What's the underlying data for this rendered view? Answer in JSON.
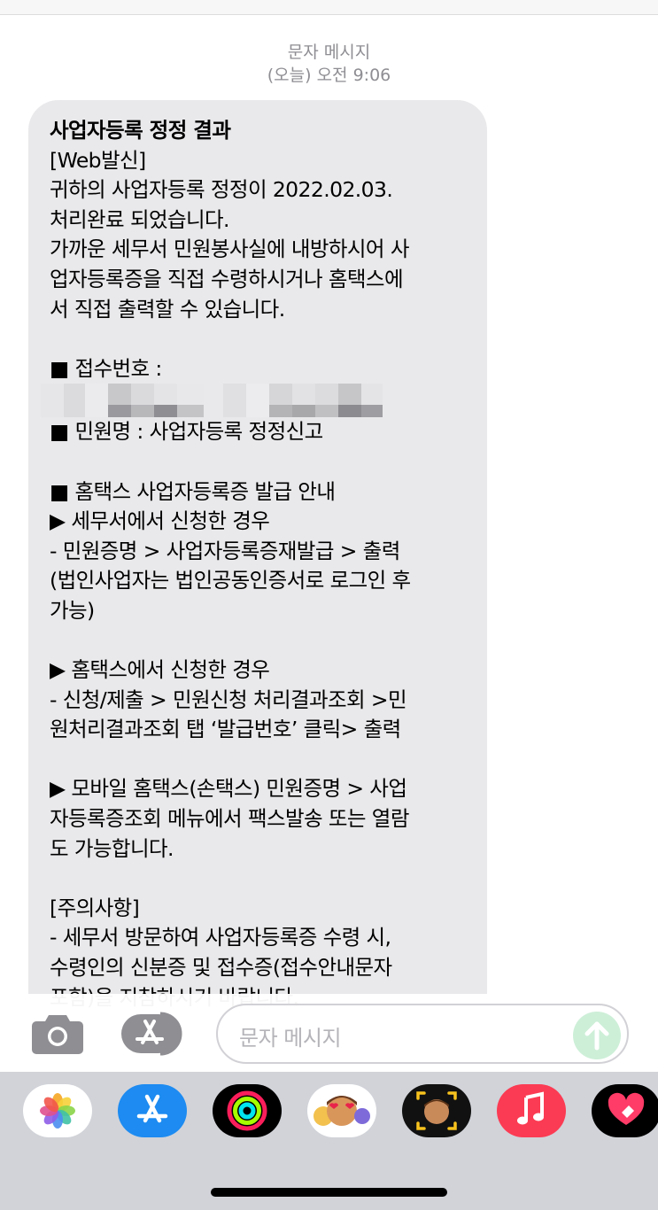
{
  "header": {
    "sender_label": "문자 메시지",
    "timestamp": "(오늘) 오전 9:06"
  },
  "message": {
    "title": "사업자등록 정정 결과",
    "lines_top": [
      "[Web발신]",
      "귀하의 사업자등록 정정이 2022.02.03.",
      "처리완료 되었습니다.",
      "가까운 세무서 민원봉사실에 내방하시어 사",
      "업자등록증을 직접 수령하시거나 홈택스에",
      "서 직접 출력할 수 있습니다."
    ],
    "receipt_label": "■ 접수번호 :",
    "lines_bottom": [
      "■ 민원명 : 사업자등록 정정신고",
      "",
      "■ 홈택스 사업자등록증 발급 안내",
      " ▶ 세무서에서 신청한 경우",
      "- 민원증명 > 사업자등록증재발급 > 출력",
      "(법인사업자는 법인공동인증서로 로그인 후",
      "가능)",
      "",
      " ▶ 홈택스에서 신청한 경우",
      "- 신청/제출 > 민원신청 처리결과조회 >민",
      "원처리결과조회 탭 ‘발급번호’ 클릭> 출력",
      "",
      " ▶ 모바일 홈택스(손택스) 민원증명 > 사업",
      "자등록증조회 메뉴에서 팩스발송 또는 열람",
      "도 가능합니다.",
      "",
      "[주의사항]",
      "- 세무서 방문하여 사업자등록증 수령 시,",
      "수령인의 신분증 및 접수증(접수안내문자",
      "포함)을 지참하시기 바랍니다."
    ]
  },
  "composer": {
    "input_placeholder": "문자 메시지"
  },
  "app_drawer": {
    "apps": [
      "photos-icon",
      "app-store-icon",
      "fitness-activity-icon",
      "memoji-stickers-icon",
      "memoji-camera-icon",
      "music-icon",
      "digital-touch-icon"
    ]
  },
  "colors": {
    "bubble": "#e9e9eb",
    "timestamp": "#8e8e93",
    "send_disabled": "#cdefd8",
    "drawer": "#d1d3d9"
  }
}
